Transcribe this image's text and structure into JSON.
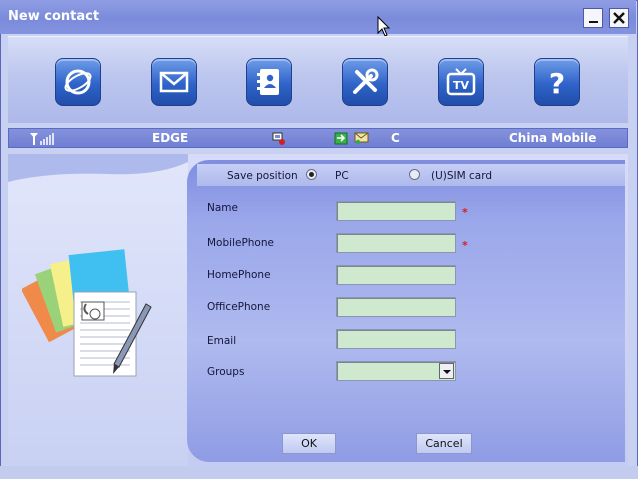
{
  "window": {
    "title": "New contact"
  },
  "titlebar_buttons": {
    "minimize": "minimize-icon",
    "close": "close-icon"
  },
  "toolbar": {
    "buttons": [
      {
        "name": "internet",
        "icon": "globe-icon"
      },
      {
        "name": "sms",
        "icon": "envelope-icon"
      },
      {
        "name": "phonebook",
        "icon": "address-book-icon"
      },
      {
        "name": "settings",
        "icon": "tools-icon"
      },
      {
        "name": "tv",
        "icon": "tv-icon"
      },
      {
        "name": "help",
        "icon": "help-icon"
      }
    ]
  },
  "status": {
    "network_type": "EDGE",
    "connection_indicator": "C",
    "operator": "China Mobile",
    "signal_icon": "signal-strength-icon"
  },
  "form": {
    "save_position_label": "Save position",
    "save_options": [
      {
        "label": "PC",
        "selected": true
      },
      {
        "label": "(U)SIM card",
        "selected": false
      }
    ],
    "fields": [
      {
        "label": "Name",
        "value": "",
        "required": true
      },
      {
        "label": "MobilePhone",
        "value": "",
        "required": true
      },
      {
        "label": "HomePhone",
        "value": "",
        "required": false
      },
      {
        "label": "OfficePhone",
        "value": "",
        "required": false
      },
      {
        "label": "Email",
        "value": "",
        "required": false
      }
    ],
    "required_mark": "*",
    "groups_label": "Groups",
    "groups_value": "",
    "ok_label": "OK",
    "cancel_label": "Cancel"
  },
  "colors": {
    "title_bar": "#7b8bdb",
    "field_bg": "#cfe9cf",
    "required": "#d62020",
    "toolbar_icon": "#2f63c9"
  }
}
